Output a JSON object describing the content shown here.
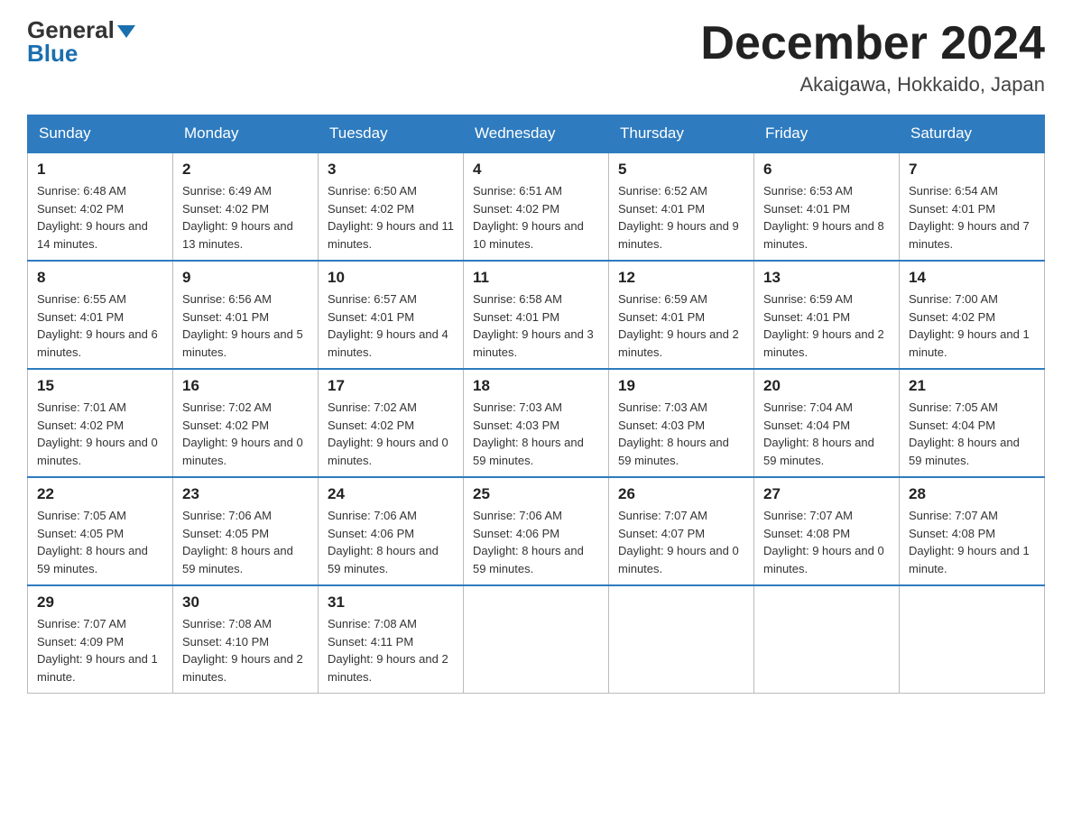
{
  "header": {
    "logo_general": "General",
    "logo_blue": "Blue",
    "month_title": "December 2024",
    "location": "Akaigawa, Hokkaido, Japan"
  },
  "days_of_week": [
    "Sunday",
    "Monday",
    "Tuesday",
    "Wednesday",
    "Thursday",
    "Friday",
    "Saturday"
  ],
  "weeks": [
    [
      {
        "day": "1",
        "sunrise": "6:48 AM",
        "sunset": "4:02 PM",
        "daylight": "9 hours and 14 minutes."
      },
      {
        "day": "2",
        "sunrise": "6:49 AM",
        "sunset": "4:02 PM",
        "daylight": "9 hours and 13 minutes."
      },
      {
        "day": "3",
        "sunrise": "6:50 AM",
        "sunset": "4:02 PM",
        "daylight": "9 hours and 11 minutes."
      },
      {
        "day": "4",
        "sunrise": "6:51 AM",
        "sunset": "4:02 PM",
        "daylight": "9 hours and 10 minutes."
      },
      {
        "day": "5",
        "sunrise": "6:52 AM",
        "sunset": "4:01 PM",
        "daylight": "9 hours and 9 minutes."
      },
      {
        "day": "6",
        "sunrise": "6:53 AM",
        "sunset": "4:01 PM",
        "daylight": "9 hours and 8 minutes."
      },
      {
        "day": "7",
        "sunrise": "6:54 AM",
        "sunset": "4:01 PM",
        "daylight": "9 hours and 7 minutes."
      }
    ],
    [
      {
        "day": "8",
        "sunrise": "6:55 AM",
        "sunset": "4:01 PM",
        "daylight": "9 hours and 6 minutes."
      },
      {
        "day": "9",
        "sunrise": "6:56 AM",
        "sunset": "4:01 PM",
        "daylight": "9 hours and 5 minutes."
      },
      {
        "day": "10",
        "sunrise": "6:57 AM",
        "sunset": "4:01 PM",
        "daylight": "9 hours and 4 minutes."
      },
      {
        "day": "11",
        "sunrise": "6:58 AM",
        "sunset": "4:01 PM",
        "daylight": "9 hours and 3 minutes."
      },
      {
        "day": "12",
        "sunrise": "6:59 AM",
        "sunset": "4:01 PM",
        "daylight": "9 hours and 2 minutes."
      },
      {
        "day": "13",
        "sunrise": "6:59 AM",
        "sunset": "4:01 PM",
        "daylight": "9 hours and 2 minutes."
      },
      {
        "day": "14",
        "sunrise": "7:00 AM",
        "sunset": "4:02 PM",
        "daylight": "9 hours and 1 minute."
      }
    ],
    [
      {
        "day": "15",
        "sunrise": "7:01 AM",
        "sunset": "4:02 PM",
        "daylight": "9 hours and 0 minutes."
      },
      {
        "day": "16",
        "sunrise": "7:02 AM",
        "sunset": "4:02 PM",
        "daylight": "9 hours and 0 minutes."
      },
      {
        "day": "17",
        "sunrise": "7:02 AM",
        "sunset": "4:02 PM",
        "daylight": "9 hours and 0 minutes."
      },
      {
        "day": "18",
        "sunrise": "7:03 AM",
        "sunset": "4:03 PM",
        "daylight": "8 hours and 59 minutes."
      },
      {
        "day": "19",
        "sunrise": "7:03 AM",
        "sunset": "4:03 PM",
        "daylight": "8 hours and 59 minutes."
      },
      {
        "day": "20",
        "sunrise": "7:04 AM",
        "sunset": "4:04 PM",
        "daylight": "8 hours and 59 minutes."
      },
      {
        "day": "21",
        "sunrise": "7:05 AM",
        "sunset": "4:04 PM",
        "daylight": "8 hours and 59 minutes."
      }
    ],
    [
      {
        "day": "22",
        "sunrise": "7:05 AM",
        "sunset": "4:05 PM",
        "daylight": "8 hours and 59 minutes."
      },
      {
        "day": "23",
        "sunrise": "7:06 AM",
        "sunset": "4:05 PM",
        "daylight": "8 hours and 59 minutes."
      },
      {
        "day": "24",
        "sunrise": "7:06 AM",
        "sunset": "4:06 PM",
        "daylight": "8 hours and 59 minutes."
      },
      {
        "day": "25",
        "sunrise": "7:06 AM",
        "sunset": "4:06 PM",
        "daylight": "8 hours and 59 minutes."
      },
      {
        "day": "26",
        "sunrise": "7:07 AM",
        "sunset": "4:07 PM",
        "daylight": "9 hours and 0 minutes."
      },
      {
        "day": "27",
        "sunrise": "7:07 AM",
        "sunset": "4:08 PM",
        "daylight": "9 hours and 0 minutes."
      },
      {
        "day": "28",
        "sunrise": "7:07 AM",
        "sunset": "4:08 PM",
        "daylight": "9 hours and 1 minute."
      }
    ],
    [
      {
        "day": "29",
        "sunrise": "7:07 AM",
        "sunset": "4:09 PM",
        "daylight": "9 hours and 1 minute."
      },
      {
        "day": "30",
        "sunrise": "7:08 AM",
        "sunset": "4:10 PM",
        "daylight": "9 hours and 2 minutes."
      },
      {
        "day": "31",
        "sunrise": "7:08 AM",
        "sunset": "4:11 PM",
        "daylight": "9 hours and 2 minutes."
      },
      null,
      null,
      null,
      null
    ]
  ],
  "labels": {
    "sunrise": "Sunrise:",
    "sunset": "Sunset:",
    "daylight": "Daylight:"
  }
}
